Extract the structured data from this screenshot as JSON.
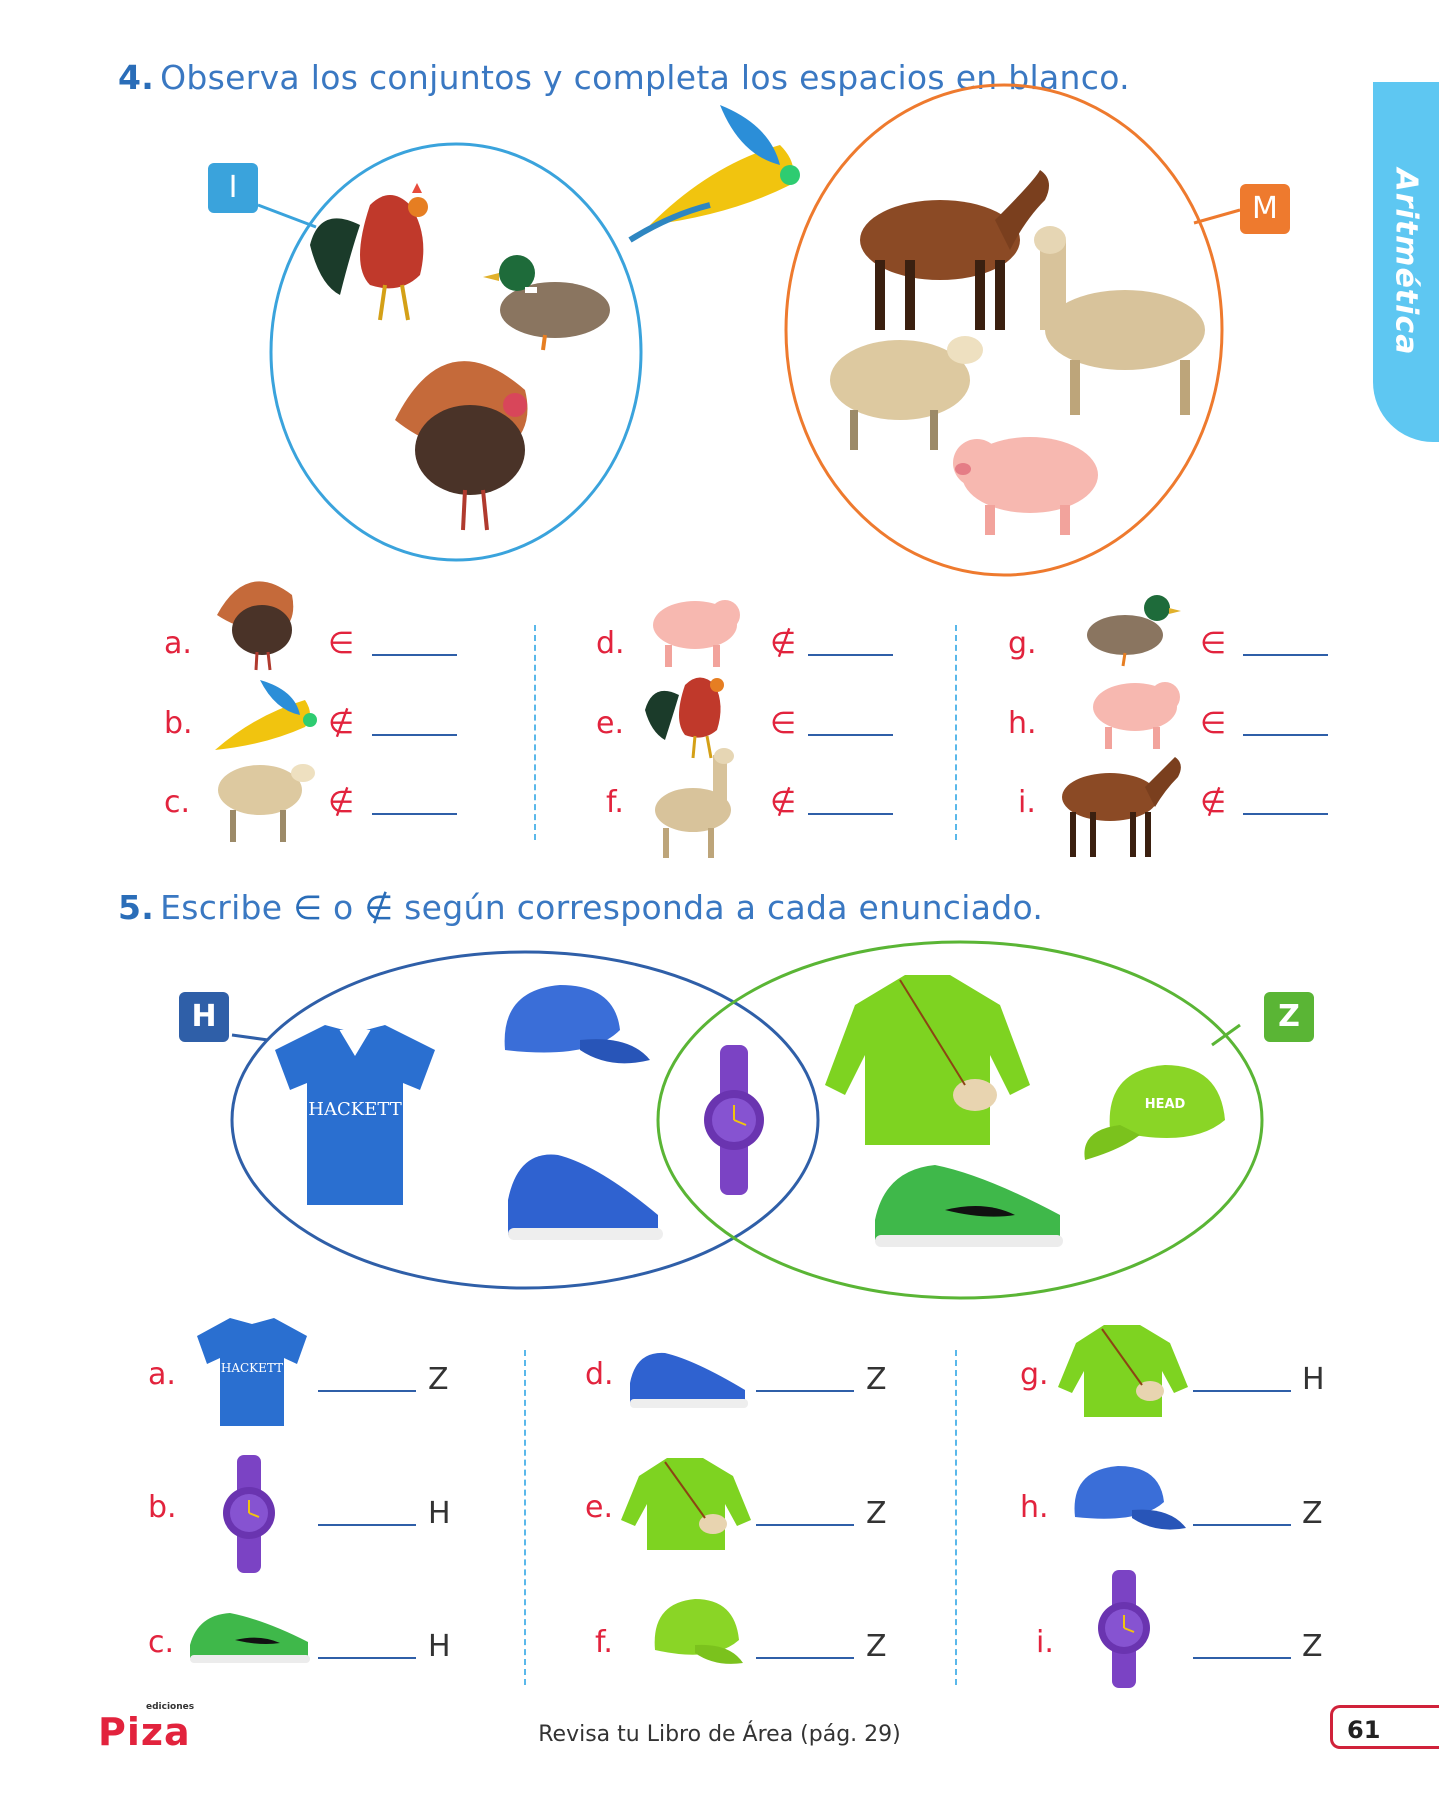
{
  "side_tab": "Aritmética",
  "ex4": {
    "number": "4.",
    "instruction": "Observa los conjuntos y completa los espacios en blanco.",
    "set_i_label": "I",
    "set_m_label": "M",
    "items": [
      {
        "letter": "a.",
        "animal": "turkey-icon",
        "relation": "∈"
      },
      {
        "letter": "b.",
        "animal": "parrot-icon",
        "relation": "∉"
      },
      {
        "letter": "c.",
        "animal": "sheep-icon",
        "relation": "∉"
      },
      {
        "letter": "d.",
        "animal": "pig-icon",
        "relation": "∉"
      },
      {
        "letter": "e.",
        "animal": "rooster-icon",
        "relation": "∈"
      },
      {
        "letter": "f.",
        "animal": "llama-icon",
        "relation": "∉"
      },
      {
        "letter": "g.",
        "animal": "duck-icon",
        "relation": "∈"
      },
      {
        "letter": "h.",
        "animal": "pig-icon",
        "relation": "∈"
      },
      {
        "letter": "i.",
        "animal": "horse-icon",
        "relation": "∉"
      }
    ]
  },
  "ex5": {
    "number": "5.",
    "instruction_pre": "Escribe",
    "sym_in": "∈",
    "instruction_mid": "o",
    "sym_notin": "∉",
    "instruction_post": "según corresponda a cada enunciado.",
    "set_h_label": "H",
    "set_z_label": "Z",
    "shirt_text": "HACKETT",
    "cap_text": "HEAD",
    "items": [
      {
        "letter": "a.",
        "item": "blue-polo-icon",
        "set": "Z"
      },
      {
        "letter": "b.",
        "item": "purple-watch-icon",
        "set": "H"
      },
      {
        "letter": "c.",
        "item": "green-sneaker-icon",
        "set": "H"
      },
      {
        "letter": "d.",
        "item": "blue-sneaker-icon",
        "set": "Z"
      },
      {
        "letter": "e.",
        "item": "green-sweater-icon",
        "set": "Z"
      },
      {
        "letter": "f.",
        "item": "green-cap-icon",
        "set": "Z"
      },
      {
        "letter": "g.",
        "item": "green-sweater-icon",
        "set": "H"
      },
      {
        "letter": "h.",
        "item": "blue-cap-icon",
        "set": "Z"
      },
      {
        "letter": "i.",
        "item": "purple-watch-icon",
        "set": "Z"
      }
    ]
  },
  "footer": {
    "logo_small": "ediciones",
    "logo": "Piza",
    "note": "Revisa tu Libro de Área (pág. 29)",
    "page": "61"
  },
  "colors": {
    "title_blue": "#3a78c2",
    "set_i": "#3aa3dc",
    "set_m": "#ee7a2e",
    "set_h": "#2f5fa8",
    "set_z": "#5ab535",
    "letter_red": "#e2233d"
  }
}
